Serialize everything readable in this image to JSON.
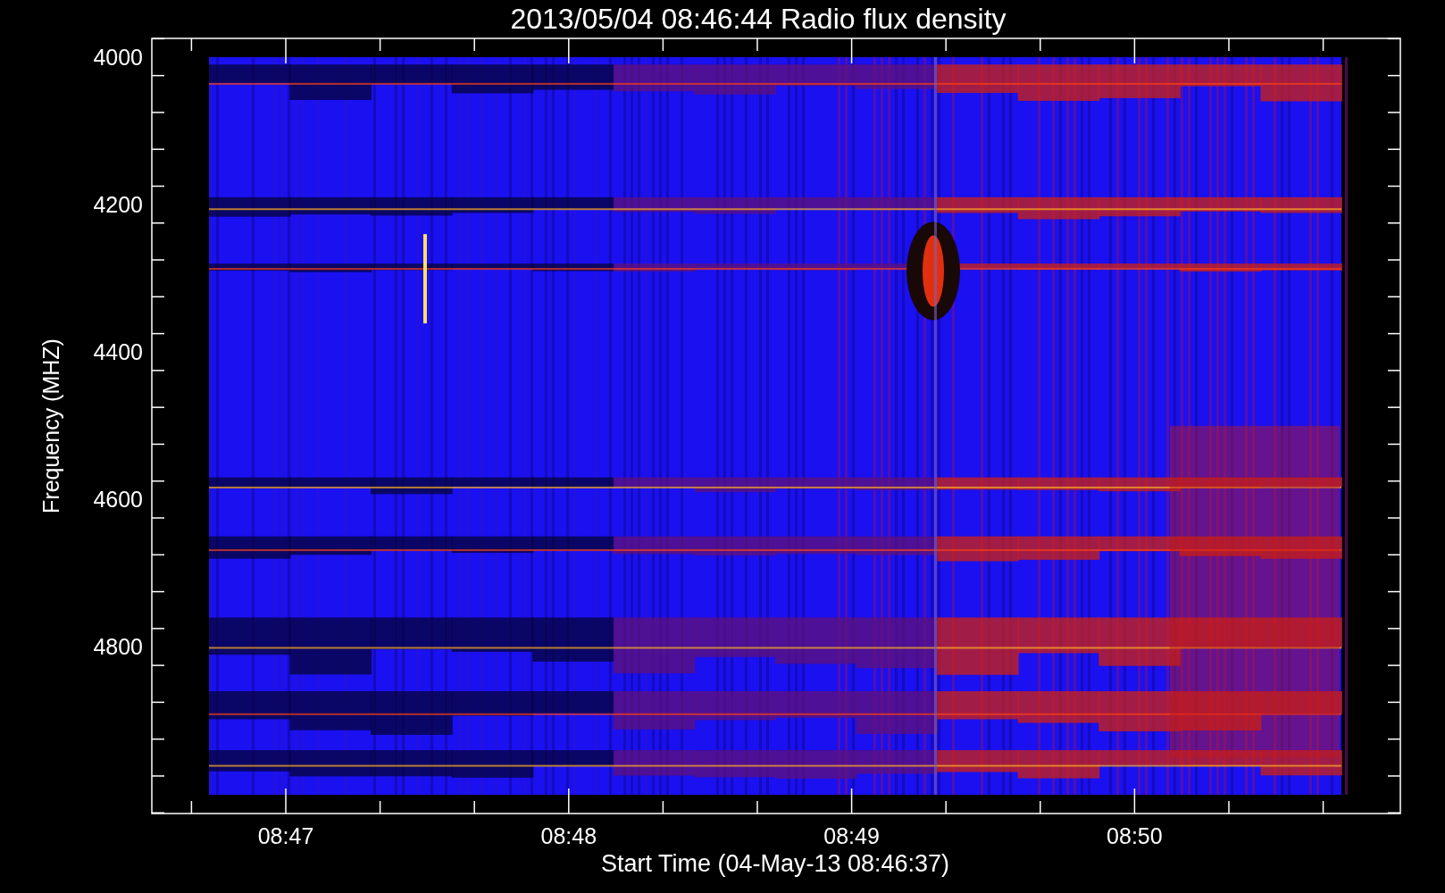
{
  "title": "2013/05/04 08:46:44 Radio flux density",
  "ylabel": "Frequency (MHZ)",
  "xlabel": "Start Time (04-May-13 08:46:37)",
  "yticks": [
    "4000",
    "4200",
    "4400",
    "4600",
    "4800"
  ],
  "xticks": [
    "08:47",
    "08:48",
    "08:49",
    "08:50"
  ]
}
